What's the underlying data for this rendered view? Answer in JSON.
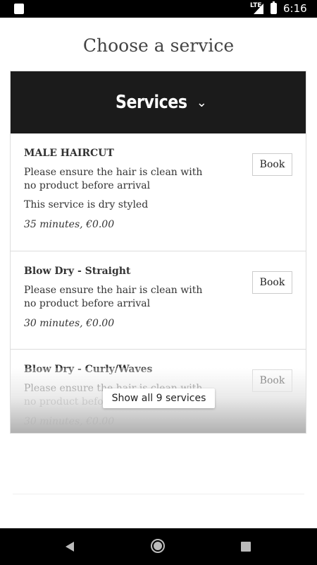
{
  "status_bar": {
    "network": "LTE",
    "time": "6:16"
  },
  "page": {
    "title": "Choose a service"
  },
  "services_header": {
    "title": "Services"
  },
  "services": [
    {
      "name": "MALE HAIRCUT",
      "description": "Please ensure the hair is clean with no product before arrival",
      "note": "This service is dry styled",
      "meta": "35 minutes, €0.00",
      "book_label": "Book"
    },
    {
      "name": "Blow Dry - Straight",
      "description": "Please ensure the hair is clean with no product before arrival",
      "meta": "30 minutes, €0.00",
      "book_label": "Book"
    },
    {
      "name": "Blow Dry - Curly/Waves",
      "description": "Please ensure the hair is clean with no product before arrival",
      "meta": "30 minutes, €0.00",
      "book_label": "Book"
    }
  ],
  "show_all": {
    "label": "Show all 9 services"
  },
  "icons": {
    "sd": "sd-card-icon",
    "signal": "signal-icon",
    "battery": "battery-charging-icon",
    "chevron": "chevron-down-icon",
    "back": "back-icon",
    "home": "home-icon",
    "recents": "recents-icon"
  }
}
